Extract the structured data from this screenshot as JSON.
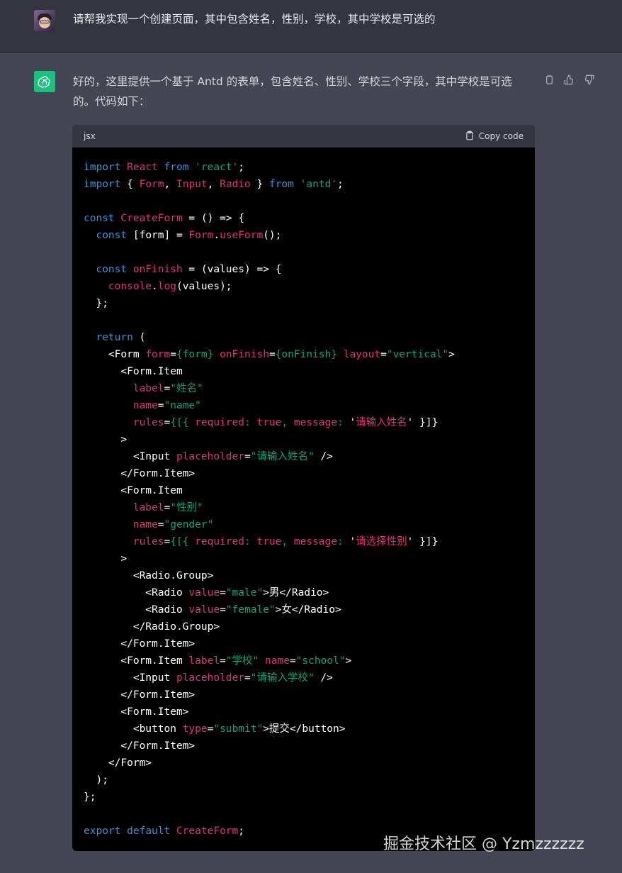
{
  "user_message": {
    "avatar": "user-avatar",
    "text": "请帮我实现一个创建页面，其中包含姓名，性别，学校，其中学校是可选的"
  },
  "assistant_message": {
    "avatar": "openai-logo-icon",
    "text": "好的，这里提供一个基于 Antd 的表单，包含姓名、性别、学校三个字段，其中学校是可选的。代码如下：",
    "actions": [
      "copy-icon",
      "thumbs-up-icon",
      "thumbs-down-icon"
    ]
  },
  "code_block": {
    "language": "jsx",
    "copy_label": "Copy code",
    "lines": [
      [
        [
          "kw",
          "import"
        ],
        [
          "txt",
          " "
        ],
        [
          "red",
          "React"
        ],
        [
          "txt",
          " "
        ],
        [
          "kw",
          "from"
        ],
        [
          "txt",
          " "
        ],
        [
          "str",
          "'react'"
        ],
        [
          "txt",
          ";"
        ]
      ],
      [
        [
          "kw",
          "import"
        ],
        [
          "txt",
          " { "
        ],
        [
          "red",
          "Form"
        ],
        [
          "txt",
          ", "
        ],
        [
          "red",
          "Input"
        ],
        [
          "txt",
          ", "
        ],
        [
          "red",
          "Radio"
        ],
        [
          "txt",
          " } "
        ],
        [
          "kw",
          "from"
        ],
        [
          "txt",
          " "
        ],
        [
          "str",
          "'antd'"
        ],
        [
          "txt",
          ";"
        ]
      ],
      [],
      [
        [
          "kw",
          "const"
        ],
        [
          "txt",
          " "
        ],
        [
          "red",
          "CreateForm"
        ],
        [
          "txt",
          " = () => {"
        ]
      ],
      [
        [
          "txt",
          "  "
        ],
        [
          "kw",
          "const"
        ],
        [
          "txt",
          " [form] = "
        ],
        [
          "red",
          "Form"
        ],
        [
          "txt",
          "."
        ],
        [
          "red",
          "useForm"
        ],
        [
          "txt",
          "();"
        ]
      ],
      [],
      [
        [
          "txt",
          "  "
        ],
        [
          "kw",
          "const"
        ],
        [
          "txt",
          " "
        ],
        [
          "red",
          "onFinish"
        ],
        [
          "txt",
          " = (values) => {"
        ]
      ],
      [
        [
          "txt",
          "    "
        ],
        [
          "red",
          "console"
        ],
        [
          "txt",
          "."
        ],
        [
          "red",
          "log"
        ],
        [
          "txt",
          "(values);"
        ]
      ],
      [
        [
          "txt",
          "  };"
        ]
      ],
      [],
      [
        [
          "txt",
          "  "
        ],
        [
          "kw",
          "return"
        ],
        [
          "txt",
          " ("
        ]
      ],
      [
        [
          "txt",
          "    <Form "
        ],
        [
          "attr",
          "form"
        ],
        [
          "txt",
          "="
        ],
        [
          "str",
          "{form}"
        ],
        [
          "txt",
          " "
        ],
        [
          "attr",
          "onFinish"
        ],
        [
          "txt",
          "="
        ],
        [
          "str",
          "{onFinish}"
        ],
        [
          "txt",
          " "
        ],
        [
          "attr",
          "layout"
        ],
        [
          "txt",
          "="
        ],
        [
          "str",
          "\"vertical\""
        ],
        [
          "txt",
          ">"
        ]
      ],
      [
        [
          "txt",
          "      <Form.Item"
        ]
      ],
      [
        [
          "txt",
          "        "
        ],
        [
          "attr",
          "label"
        ],
        [
          "txt",
          "="
        ],
        [
          "str",
          "\"姓名\""
        ]
      ],
      [
        [
          "txt",
          "        "
        ],
        [
          "attr",
          "name"
        ],
        [
          "txt",
          "="
        ],
        [
          "str",
          "\"name\""
        ]
      ],
      [
        [
          "txt",
          "        "
        ],
        [
          "attr",
          "rules"
        ],
        [
          "txt",
          "="
        ],
        [
          "str",
          "{[{ "
        ],
        [
          "attr",
          "required"
        ],
        [
          "str",
          ": "
        ],
        [
          "attr",
          "true"
        ],
        [
          "str",
          ", "
        ],
        [
          "attr",
          "message"
        ],
        [
          "str",
          ": "
        ],
        [
          "txt",
          "'"
        ],
        [
          "red",
          "请输入姓名"
        ],
        [
          "txt",
          "' }]}"
        ]
      ],
      [
        [
          "txt",
          "      >"
        ]
      ],
      [
        [
          "txt",
          "        <Input "
        ],
        [
          "attr",
          "placeholder"
        ],
        [
          "txt",
          "="
        ],
        [
          "str",
          "\"请输入姓名\""
        ],
        [
          "txt",
          " />"
        ]
      ],
      [
        [
          "txt",
          "      </Form.Item>"
        ]
      ],
      [
        [
          "txt",
          "      <Form.Item"
        ]
      ],
      [
        [
          "txt",
          "        "
        ],
        [
          "attr",
          "label"
        ],
        [
          "txt",
          "="
        ],
        [
          "str",
          "\"性别\""
        ]
      ],
      [
        [
          "txt",
          "        "
        ],
        [
          "attr",
          "name"
        ],
        [
          "txt",
          "="
        ],
        [
          "str",
          "\"gender\""
        ]
      ],
      [
        [
          "txt",
          "        "
        ],
        [
          "attr",
          "rules"
        ],
        [
          "txt",
          "="
        ],
        [
          "str",
          "{[{ "
        ],
        [
          "attr",
          "required"
        ],
        [
          "str",
          ": "
        ],
        [
          "attr",
          "true"
        ],
        [
          "str",
          ", "
        ],
        [
          "attr",
          "message"
        ],
        [
          "str",
          ": "
        ],
        [
          "txt",
          "'"
        ],
        [
          "red",
          "请选择性别"
        ],
        [
          "txt",
          "' }]}"
        ]
      ],
      [
        [
          "txt",
          "      >"
        ]
      ],
      [
        [
          "txt",
          "        <Radio.Group>"
        ]
      ],
      [
        [
          "txt",
          "          <Radio "
        ],
        [
          "attr",
          "value"
        ],
        [
          "txt",
          "="
        ],
        [
          "str",
          "\"male\""
        ],
        [
          "txt",
          ">男</Radio>"
        ]
      ],
      [
        [
          "txt",
          "          <Radio "
        ],
        [
          "attr",
          "value"
        ],
        [
          "txt",
          "="
        ],
        [
          "str",
          "\"female\""
        ],
        [
          "txt",
          ">女</Radio>"
        ]
      ],
      [
        [
          "txt",
          "        </Radio.Group>"
        ]
      ],
      [
        [
          "txt",
          "      </Form.Item>"
        ]
      ],
      [
        [
          "txt",
          "      <Form.Item "
        ],
        [
          "attr",
          "label"
        ],
        [
          "txt",
          "="
        ],
        [
          "str",
          "\"学校\""
        ],
        [
          "txt",
          " "
        ],
        [
          "attr",
          "name"
        ],
        [
          "txt",
          "="
        ],
        [
          "str",
          "\"school\""
        ],
        [
          "txt",
          ">"
        ]
      ],
      [
        [
          "txt",
          "        <Input "
        ],
        [
          "attr",
          "placeholder"
        ],
        [
          "txt",
          "="
        ],
        [
          "str",
          "\"请输入学校\""
        ],
        [
          "txt",
          " />"
        ]
      ],
      [
        [
          "txt",
          "      </Form.Item>"
        ]
      ],
      [
        [
          "txt",
          "      <Form.Item>"
        ]
      ],
      [
        [
          "txt",
          "        <button "
        ],
        [
          "attr",
          "type"
        ],
        [
          "txt",
          "="
        ],
        [
          "str",
          "\"submit\""
        ],
        [
          "txt",
          ">提交</button>"
        ]
      ],
      [
        [
          "txt",
          "      </Form.Item>"
        ]
      ],
      [
        [
          "txt",
          "    </Form>"
        ]
      ],
      [
        [
          "txt",
          "  );"
        ]
      ],
      [
        [
          "txt",
          "};"
        ]
      ],
      [],
      [
        [
          "kw",
          "export"
        ],
        [
          "txt",
          " "
        ],
        [
          "kw",
          "default"
        ],
        [
          "txt",
          " "
        ],
        [
          "red",
          "CreateForm"
        ],
        [
          "txt",
          ";"
        ]
      ]
    ]
  },
  "watermark": "掘金技术社区 @ Yzmzzzzzz",
  "colors": {
    "page_bg": "#444654",
    "user_row_bg": "#343541",
    "code_bg": "#000000",
    "code_header_bg": "#343541",
    "keyword": "#2e95d3",
    "identifier": "#df3079",
    "string": "#00a67d",
    "openai_green": "#19c37d"
  }
}
